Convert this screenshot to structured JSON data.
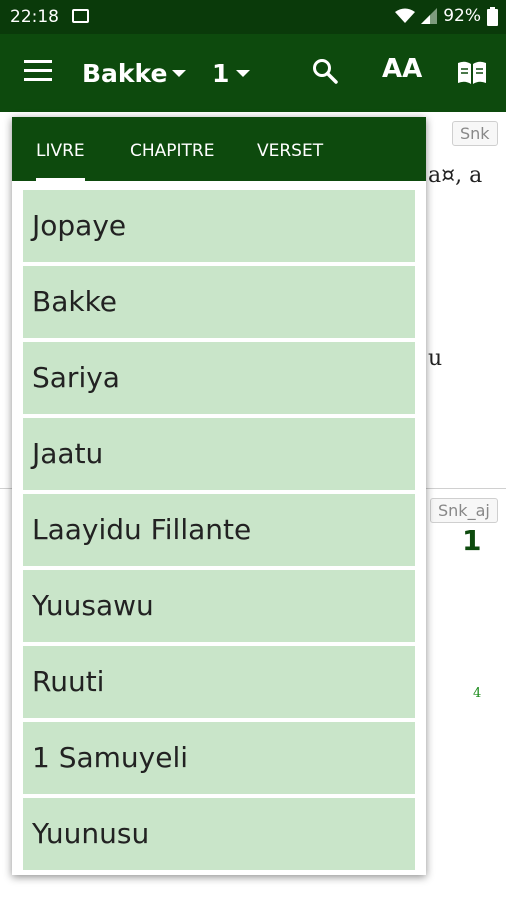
{
  "status_bar": {
    "time": "22:18",
    "battery": "92%"
  },
  "app_bar": {
    "book": "Bakke",
    "chapter": "1",
    "text_size_icon": "AA"
  },
  "background": {
    "chip_top": "Snk",
    "chip_bottom": "Snk_aj",
    "verse_number": "1",
    "frag1": "a¤, a",
    "frag2": "u",
    "verse_ref": "4"
  },
  "popup": {
    "tabs": [
      {
        "label": "LIVRE",
        "active": true
      },
      {
        "label": "CHAPITRE",
        "active": false
      },
      {
        "label": "VERSET",
        "active": false
      }
    ],
    "books": [
      "Jopaye",
      "Bakke",
      "Sariya",
      "Jaatu",
      "Laayidu Fillante",
      "Yuusawu",
      "Ruuti",
      "1 Samuyeli",
      "Yuunusu"
    ]
  },
  "colors": {
    "status": "#0a3a0a",
    "appbar": "#0d4a0d",
    "item": "#c9e5c9"
  }
}
